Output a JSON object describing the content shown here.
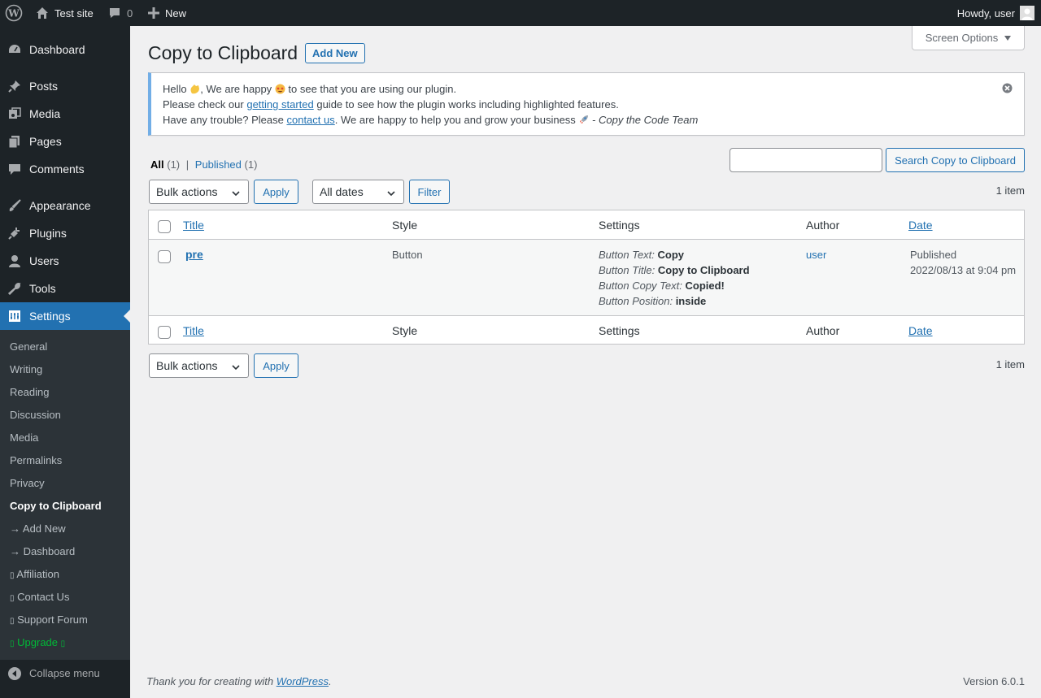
{
  "adminbar": {
    "site_name": "Test site",
    "comments_count": "0",
    "new_label": "New",
    "howdy": "Howdy, user"
  },
  "menu": {
    "items": [
      {
        "label": "Dashboard",
        "icon": "dashboard-icon"
      },
      {
        "label": "Posts",
        "icon": "pin-icon"
      },
      {
        "label": "Media",
        "icon": "media-icon"
      },
      {
        "label": "Pages",
        "icon": "pages-icon"
      },
      {
        "label": "Comments",
        "icon": "comment-icon"
      },
      {
        "label": "Appearance",
        "icon": "brush-icon"
      },
      {
        "label": "Plugins",
        "icon": "plugin-icon"
      },
      {
        "label": "Users",
        "icon": "user-icon"
      },
      {
        "label": "Tools",
        "icon": "wrench-icon"
      },
      {
        "label": "Settings",
        "icon": "settings-icon"
      }
    ],
    "submenu": [
      "General",
      "Writing",
      "Reading",
      "Discussion",
      "Media",
      "Permalinks",
      "Privacy",
      "Copy to Clipboard",
      "→ Add New",
      "→ Dashboard",
      "Affiliation",
      "Contact Us",
      "Support Forum",
      "Upgrade"
    ],
    "collapse": "Collapse menu"
  },
  "screen_options": "Screen Options",
  "page": {
    "title": "Copy to Clipboard",
    "add_new": "Add New"
  },
  "notice": {
    "l1_a": "Hello ",
    "l1_b": ", We are happy ",
    "l1_c": " to see that you are using our plugin.",
    "l2_a": "Please check our ",
    "l2_link": "getting started",
    "l2_b": " guide to see how the plugin works including highlighted features.",
    "l3_a": "Have any trouble? Please ",
    "l3_link": "contact us",
    "l3_b": ". We are happy to help you and grow your business ",
    "l3_c": " - Copy the Code Team"
  },
  "filters": {
    "all": "All",
    "all_count": "(1)",
    "sep": "|",
    "published": "Published",
    "published_count": "(1)"
  },
  "search": {
    "value": "",
    "button": "Search Copy to Clipboard"
  },
  "tablenav": {
    "bulk_actions": "Bulk actions",
    "apply": "Apply",
    "all_dates": "All dates",
    "filter": "Filter",
    "count": "1 item"
  },
  "table": {
    "columns": [
      "Title",
      "Style",
      "Settings",
      "Author",
      "Date"
    ],
    "row": {
      "title": "pre",
      "style": "Button",
      "settings": [
        {
          "key": "Button Text:",
          "value": "Copy"
        },
        {
          "key": "Button Title:",
          "value": "Copy to Clipboard"
        },
        {
          "key": "Button Copy Text:",
          "value": "Copied!"
        },
        {
          "key": "Button Position:",
          "value": "inside"
        }
      ],
      "author": "user",
      "date_status": "Published",
      "date_value": "2022/08/13 at 9:04 pm"
    }
  },
  "footer": {
    "thanks_a": "Thank you for creating with ",
    "thanks_link": "WordPress",
    "thanks_b": ".",
    "version": "Version 6.0.1"
  }
}
